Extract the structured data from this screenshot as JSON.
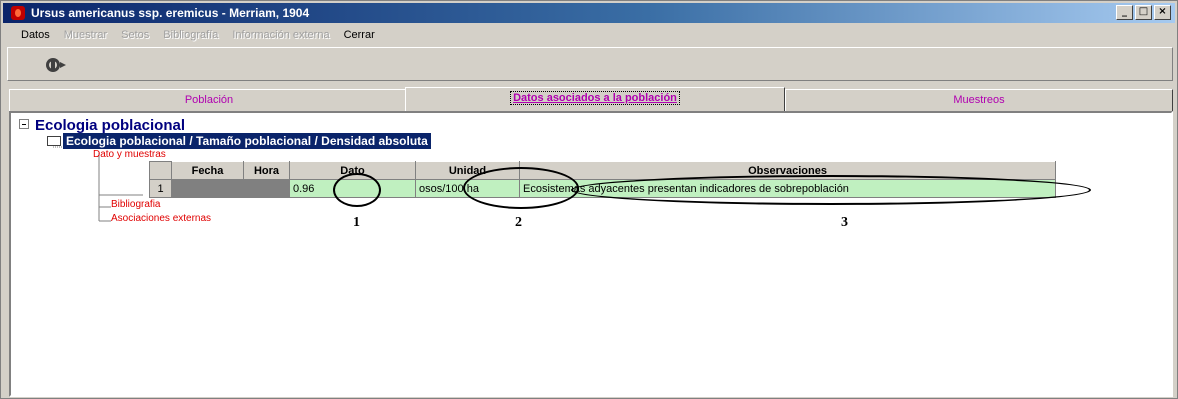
{
  "window": {
    "title": "Ursus americanus ssp. eremicus - Merriam, 1904",
    "controls": [
      "_",
      "□",
      "×"
    ]
  },
  "menu": [
    {
      "label": "Datos",
      "enabled": true
    },
    {
      "label": "Muestrar",
      "enabled": false
    },
    {
      "label": "Setos",
      "enabled": false
    },
    {
      "label": "Bibliografía",
      "enabled": false
    },
    {
      "label": "Información externa",
      "enabled": false
    },
    {
      "label": "Cerrar",
      "enabled": true
    }
  ],
  "toolbar": {
    "button_icon": "exit-door-icon"
  },
  "tabs": [
    {
      "label": "Población",
      "active": false
    },
    {
      "label": "Datos asociados a la población",
      "active": true
    },
    {
      "label": "Muestreos",
      "active": false
    }
  ],
  "tree": {
    "root_label": "Ecologia poblacional",
    "node_label": "Ecologia poblacional / Tamaño poblacional / Densidad absoluta",
    "children": {
      "data_label": "Dato y muestras",
      "bibliography_label": "Bibliografia",
      "external_label": "Asociaciones externas"
    }
  },
  "grid": {
    "columns": [
      "Fecha",
      "Hora",
      "Dato",
      "Unidad",
      "Observaciones"
    ],
    "rows": [
      {
        "num": "1",
        "fecha": "",
        "hora": "",
        "dato": "0.96",
        "unidad": "osos/100 ha",
        "observaciones": "Ecosistemas adyacentes presentan indicadores de sobrepoblación"
      }
    ]
  },
  "callouts": [
    "1",
    "2",
    "3"
  ],
  "colors": {
    "title_bar": "#0a246a",
    "tab_text": "#b000b0",
    "tree_root": "#00007f",
    "tree_leaf": "#e00000",
    "cell_green": "#c0f0c0"
  }
}
